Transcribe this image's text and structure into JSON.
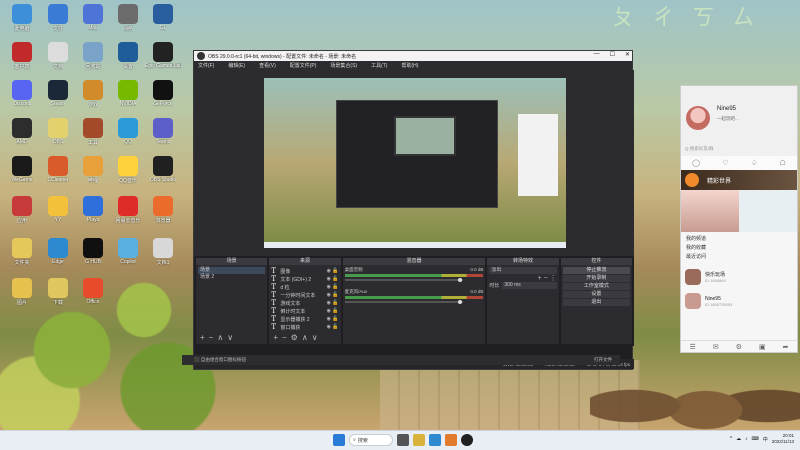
{
  "desktop": {
    "icons": [
      {
        "label": "此电脑",
        "color": "#3e8fd9"
      },
      {
        "label": "文件",
        "color": "#3a7bd5"
      },
      {
        "label": "Mitu",
        "color": "#4f74d8"
      },
      {
        "label": "网络",
        "color": "#6c6c6c"
      },
      {
        "label": "GL",
        "color": "#2a5d9e"
      },
      {
        "label": "客户端",
        "color": "#c02a2a"
      },
      {
        "label": "文档",
        "color": "#dcdcdc"
      },
      {
        "label": "回收站",
        "color": "#7aa3c9"
      },
      {
        "label": "设置",
        "color": "#1e5c9a"
      },
      {
        "label": "Epic Games Launcher",
        "color": "#222"
      },
      {
        "label": "Discord",
        "color": "#5865f2"
      },
      {
        "label": "Steam",
        "color": "#1b2838"
      },
      {
        "label": "游戏",
        "color": "#d28b2a"
      },
      {
        "label": "NVIDIA",
        "color": "#76b900"
      },
      {
        "label": "GeForce",
        "color": "#111"
      },
      {
        "label": "AMD",
        "color": "#2d2d2d"
      },
      {
        "label": "OBS",
        "color": "#e2d16d"
      },
      {
        "label": "工具",
        "color": "#a34a2b"
      },
      {
        "label": "QQ",
        "color": "#2a9bd7"
      },
      {
        "label": "Teams",
        "color": "#5b5fc7"
      },
      {
        "label": "WeGame",
        "color": "#1a1a1a"
      },
      {
        "label": "CCleaner",
        "color": "#d95a2b"
      },
      {
        "label": "哔哩",
        "color": "#e8a03a"
      },
      {
        "label": "QQ音乐",
        "color": "#ffd13a"
      },
      {
        "label": "OBS Studio",
        "color": "#202020"
      },
      {
        "label": "应用",
        "color": "#c63a3a"
      },
      {
        "label": "YY",
        "color": "#f3c23a"
      },
      {
        "label": "Plays",
        "color": "#2f6fdb"
      },
      {
        "label": "网易云音乐",
        "color": "#e02b2b"
      },
      {
        "label": "浏览器",
        "color": "#ea6b2b"
      },
      {
        "label": "文件夹",
        "color": "#e6c85a"
      },
      {
        "label": "Edge",
        "color": "#2e8ad0"
      },
      {
        "label": "G HUB",
        "color": "#101010"
      },
      {
        "label": "Copilot",
        "color": "#5ab1e0"
      },
      {
        "label": "文档1",
        "color": "#d8d8d8"
      },
      {
        "label": "图片",
        "color": "#e7c14e"
      },
      {
        "label": "下载",
        "color": "#e0c65e"
      },
      {
        "label": "Office",
        "color": "#e74b2b"
      }
    ]
  },
  "obs": {
    "title": "OBS 29.0.0-rc1 (64-bit, windows) - 配置文件: 未命名 - 场景: 未命名",
    "window_controls": [
      "—",
      "☐",
      "✕"
    ],
    "menu": [
      "文件(F)",
      "编辑(E)",
      "查看(V)",
      "配置文件(P)",
      "场景集合(S)",
      "工具(T)",
      "帮助(H)"
    ],
    "docks": {
      "scenes": {
        "title": "场景",
        "items": [
          "场景",
          "场景 2"
        ]
      },
      "sources": {
        "title": "来源",
        "items": [
          "图像",
          "文本 (GDI+) 2",
          "d 粒",
          "一分钟时间文本",
          "游戏文本",
          "倒计时文本",
          "显示器捕获 2",
          "窗口捕获"
        ]
      },
      "mixer": {
        "title": "混音器",
        "tracks": [
          {
            "name": "桌面音频",
            "db": "0.0 dB"
          },
          {
            "name": "麦克风/Aux",
            "db": "0.0 dB"
          }
        ]
      },
      "transitions": {
        "title": "转场特效",
        "type": "淡出",
        "duration_label": "时长",
        "duration": "300 ms"
      },
      "controls": {
        "title": "控件",
        "buttons": [
          "停止推流",
          "开始录制",
          "工作室模式",
          "设置",
          "退出"
        ]
      }
    },
    "status": {
      "live": "LIVE: 00:00:00",
      "rec": "REC: 00:00:00",
      "cpu": "CPU: 0.7%, 59.94 fps"
    }
  },
  "bottom_dock": {
    "left": "⬛ 自由组合窗口图标按钮",
    "right": "打开文件"
  },
  "chat": {
    "user_name": "Nine95",
    "user_status": "一起玩吧...",
    "search_placeholder": "Q 搜索好友/群",
    "banner": "精彩世界",
    "menu": [
      "我的频道",
      "我的收藏",
      "最近访问"
    ],
    "contacts": [
      {
        "name": "快乐玩场",
        "id": "ID 1654869"
      },
      {
        "name": "Nine95",
        "id": "ID 1655735093"
      }
    ],
    "tabs": [
      "◯",
      "♡",
      "♤",
      "☖"
    ],
    "footer_icons": [
      "☰",
      "✉",
      "⚙",
      "▣",
      "➦"
    ]
  },
  "taskbar": {
    "search": "搜索",
    "time": "20:01",
    "date": "2022/11/13",
    "tray": [
      "^",
      "☁",
      "♪",
      "⌨",
      "中"
    ]
  },
  "wallpaper_text": "ㄆ ㄔ ㄎ ㄙ"
}
